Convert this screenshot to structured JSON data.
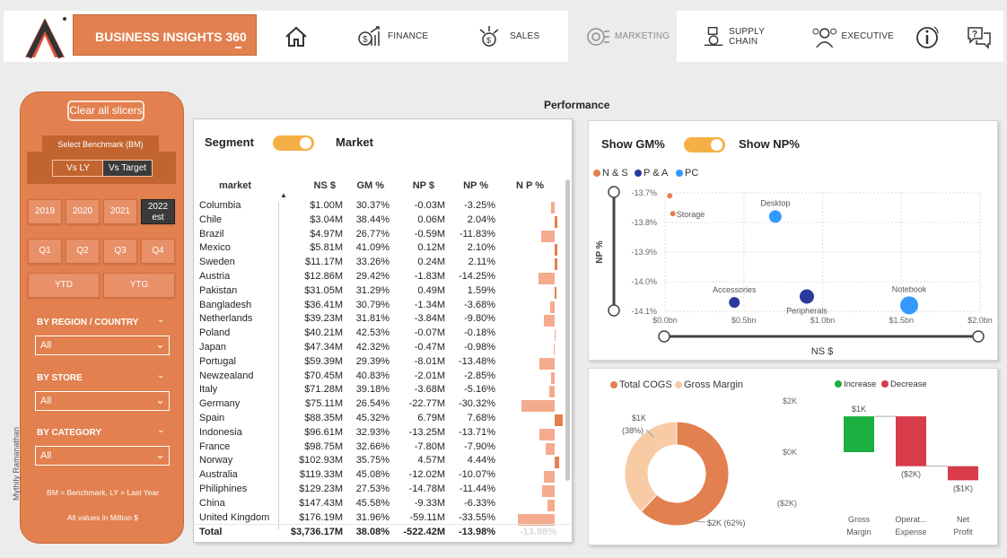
{
  "brand": {
    "title": "BUSINESS INSIGHTS 360"
  },
  "nav": [
    {
      "label": "",
      "icon": "home-icon"
    },
    {
      "label": "FINANCE",
      "icon": "finance-icon"
    },
    {
      "label": "SALES",
      "icon": "sales-icon"
    },
    {
      "label": "MARKETING",
      "icon": "marketing-icon"
    },
    {
      "label": "SUPPLY CHAIN",
      "icon": "supply-chain-icon"
    },
    {
      "label": "EXECUTIVE",
      "icon": "executive-icon"
    },
    {
      "label": "",
      "icon": "info-icon"
    },
    {
      "label": "",
      "icon": "help-chat-icon"
    }
  ],
  "slicer": {
    "clear": "Clear all slicers",
    "benchmark_label": "Select Benchmark (BM)",
    "vs_ly": "Vs LY",
    "vs_target": "Vs Target",
    "years": [
      "2019",
      "2020",
      "2021",
      "2022",
      "est"
    ],
    "quarters": [
      "Q1",
      "Q2",
      "Q3",
      "Q4"
    ],
    "ytd": "YTD",
    "ytg": "YTG",
    "region_label": "BY REGION / COUNTRY",
    "region_value": "All",
    "store_label": "BY STORE",
    "store_value": "All",
    "category_label": "BY CATEGORY",
    "category_value": "All",
    "note1": "BM = Benchmark, LY = Last Year",
    "note2": "All values in Million $",
    "author": "Mythily Ramanathan"
  },
  "performance": {
    "title": "Performance",
    "toggle_left": "Segment",
    "toggle_right": "Market",
    "headers": [
      "market",
      "NS $",
      "GM %",
      "NP $",
      "NP %",
      "N P %"
    ],
    "rows": [
      {
        "market": "Columbia",
        "ns": "$1.00M",
        "gm": "30.37%",
        "np": "-0.03M",
        "npp": "-3.25%",
        "v": -3.25
      },
      {
        "market": "Chile",
        "ns": "$3.04M",
        "gm": "38.44%",
        "np": "0.06M",
        "npp": "2.04%",
        "v": 2.04
      },
      {
        "market": "Brazil",
        "ns": "$4.97M",
        "gm": "26.77%",
        "np": "-0.59M",
        "npp": "-11.83%",
        "v": -11.83
      },
      {
        "market": "Mexico",
        "ns": "$5.81M",
        "gm": "41.09%",
        "np": "0.12M",
        "npp": "2.10%",
        "v": 2.1
      },
      {
        "market": "Sweden",
        "ns": "$11.17M",
        "gm": "33.26%",
        "np": "0.24M",
        "npp": "2.11%",
        "v": 2.11
      },
      {
        "market": "Austria",
        "ns": "$12.86M",
        "gm": "29.42%",
        "np": "-1.83M",
        "npp": "-14.25%",
        "v": -14.25
      },
      {
        "market": "Pakistan",
        "ns": "$31.05M",
        "gm": "31.29%",
        "np": "0.49M",
        "npp": "1.59%",
        "v": 1.59
      },
      {
        "market": "Bangladesh",
        "ns": "$36.41M",
        "gm": "30.79%",
        "np": "-1.34M",
        "npp": "-3.68%",
        "v": -3.68
      },
      {
        "market": "Netherlands",
        "ns": "$39.23M",
        "gm": "31.81%",
        "np": "-3.84M",
        "npp": "-9.80%",
        "v": -9.8
      },
      {
        "market": "Poland",
        "ns": "$40.21M",
        "gm": "42.53%",
        "np": "-0.07M",
        "npp": "-0.18%",
        "v": -0.18
      },
      {
        "market": "Japan",
        "ns": "$47.34M",
        "gm": "42.32%",
        "np": "-0.47M",
        "npp": "-0.98%",
        "v": -0.98
      },
      {
        "market": "Portugal",
        "ns": "$59.39M",
        "gm": "29.39%",
        "np": "-8.01M",
        "npp": "-13.48%",
        "v": -13.48
      },
      {
        "market": "Newzealand",
        "ns": "$70.45M",
        "gm": "40.83%",
        "np": "-2.01M",
        "npp": "-2.85%",
        "v": -2.85
      },
      {
        "market": "Italy",
        "ns": "$71.28M",
        "gm": "39.18%",
        "np": "-3.68M",
        "npp": "-5.16%",
        "v": -5.16
      },
      {
        "market": "Germany",
        "ns": "$75.11M",
        "gm": "26.54%",
        "np": "-22.77M",
        "npp": "-30.32%",
        "v": -30.32
      },
      {
        "market": "Spain",
        "ns": "$88.35M",
        "gm": "45.32%",
        "np": "6.79M",
        "npp": "7.68%",
        "v": 7.68
      },
      {
        "market": "Indonesia",
        "ns": "$96.61M",
        "gm": "32.93%",
        "np": "-13.25M",
        "npp": "-13.71%",
        "v": -13.71
      },
      {
        "market": "France",
        "ns": "$98.75M",
        "gm": "32.66%",
        "np": "-7.80M",
        "npp": "-7.90%",
        "v": -7.9
      },
      {
        "market": "Norway",
        "ns": "$102.93M",
        "gm": "35.75%",
        "np": "4.57M",
        "npp": "4.44%",
        "v": 4.44
      },
      {
        "market": "Australia",
        "ns": "$119.33M",
        "gm": "45.08%",
        "np": "-12.02M",
        "npp": "-10.07%",
        "v": -10.07
      },
      {
        "market": "Philiphines",
        "ns": "$129.23M",
        "gm": "27.53%",
        "np": "-14.78M",
        "npp": "-11.44%",
        "v": -11.44
      },
      {
        "market": "China",
        "ns": "$147.43M",
        "gm": "45.58%",
        "np": "-9.33M",
        "npp": "-6.33%",
        "v": -6.33
      },
      {
        "market": "United Kingdom",
        "ns": "$176.19M",
        "gm": "31.96%",
        "np": "-59.11M",
        "npp": "-33.55%",
        "v": -33.55
      }
    ],
    "total": {
      "label": "Total",
      "ns": "$3,736.17M",
      "gm": "38.08%",
      "np": "-522.42M",
      "npp": "-13.98%",
      "bar": "-13.98%"
    },
    "colors": {
      "neg": "#f4ab8e",
      "pos": "#e2804f"
    }
  },
  "scatter": {
    "toggle_left": "Show GM%",
    "toggle_right": "Show NP%",
    "legend": [
      {
        "label": "N & S",
        "color": "#e2804f"
      },
      {
        "label": "P & A",
        "color": "#2b3a9e"
      },
      {
        "label": "PC",
        "color": "#3399ff"
      }
    ],
    "ylabel": "NP %",
    "xlabel": "NS $",
    "yticks": [
      "-13.7%",
      "-13.8%",
      "-13.9%",
      "-14.0%",
      "-14.1%"
    ],
    "xticks": [
      "$0.0bn",
      "$0.5bn",
      "$1.0bn",
      "$1.5bn",
      "$2.0bn"
    ],
    "chart_data": {
      "type": "scatter",
      "xlabel": "NS $",
      "ylabel": "NP %",
      "xlim": [
        0,
        2.0
      ],
      "ylim": [
        -14.1,
        -13.7
      ],
      "points": [
        {
          "label": "",
          "series": "N & S",
          "x": 0.03,
          "y": -13.71,
          "size": 3
        },
        {
          "label": "Storage",
          "series": "N & S",
          "x": 0.05,
          "y": -13.77,
          "size": 3
        },
        {
          "label": "Desktop",
          "series": "PC",
          "x": 0.7,
          "y": -13.78,
          "size": 7
        },
        {
          "label": "Accessories",
          "series": "P & A",
          "x": 0.44,
          "y": -14.07,
          "size": 6
        },
        {
          "label": "Peripherals",
          "series": "P & A",
          "x": 0.9,
          "y": -14.05,
          "size": 8
        },
        {
          "label": "Notebook",
          "series": "PC",
          "x": 1.55,
          "y": -14.08,
          "size": 10
        }
      ]
    }
  },
  "donut": {
    "legend": [
      {
        "label": "Total COGS",
        "color": "#e2804f"
      },
      {
        "label": "Gross Margin",
        "color": "#f8cba5"
      }
    ],
    "label_gm_value": "$1K",
    "label_gm_pct": "(38%)",
    "label_cogs": "$2K (62%)",
    "chart_data": {
      "type": "pie",
      "categories": [
        "Total COGS",
        "Gross Margin"
      ],
      "values": [
        62,
        38
      ]
    }
  },
  "waterfall": {
    "legend": [
      {
        "label": "Increase",
        "color": "#1aaf3f"
      },
      {
        "label": "Decrease",
        "color": "#d83b4a"
      }
    ],
    "yticks": [
      "$2K",
      "$0K",
      "($2K)"
    ],
    "bar_labels": [
      "$1K",
      "($2K)",
      "($1K)"
    ],
    "categories": [
      "Gross Margin",
      "Operat... Expense",
      "Net Profit"
    ],
    "chart_data": {
      "type": "bar",
      "categories": [
        "Gross Margin",
        "Operat... Expense",
        "Net Profit"
      ],
      "values": [
        1.4,
        -1.95,
        -0.55
      ],
      "ylim": [
        -2,
        2
      ]
    }
  }
}
